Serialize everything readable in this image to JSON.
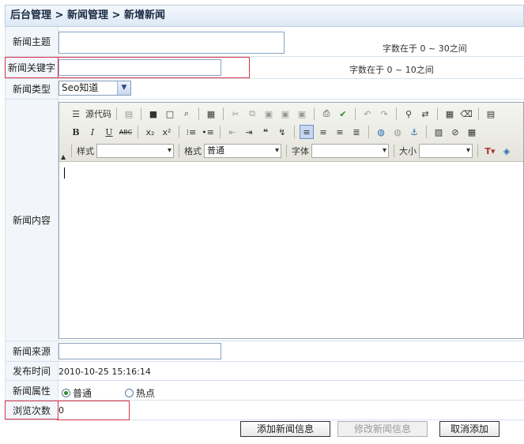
{
  "breadcrumb": {
    "item1": "后台管理",
    "sep": " > ",
    "item2": "新闻管理",
    "item3": "新增新闻"
  },
  "fields": {
    "subject": {
      "label": "新闻主题",
      "value": "",
      "hint": "字数在于 0 ~ 30之间"
    },
    "keywords": {
      "label": "新闻关键字",
      "value": "",
      "hint": "字数在于 0 ~ 10之间"
    },
    "type": {
      "label": "新闻类型",
      "selected": "Seo知道"
    },
    "content": {
      "label": "新闻内容"
    },
    "source": {
      "label": "新闻来源",
      "value": ""
    },
    "publish_time": {
      "label": "发布时间",
      "value": "2010-10-25 15:16:14"
    },
    "attribute": {
      "label": "新闻属性",
      "options": [
        "普通",
        "热点"
      ],
      "selected": "普通"
    },
    "views": {
      "label": "浏览次数",
      "value": "0"
    }
  },
  "editor": {
    "source_label": "源代码",
    "style_label": "样式",
    "format_label": "格式",
    "format_value": "普通",
    "font_label": "字体",
    "size_label": "大小"
  },
  "buttons": {
    "add": "添加新闻信息",
    "modify": "修改新闻信息",
    "cancel": "取消添加"
  }
}
